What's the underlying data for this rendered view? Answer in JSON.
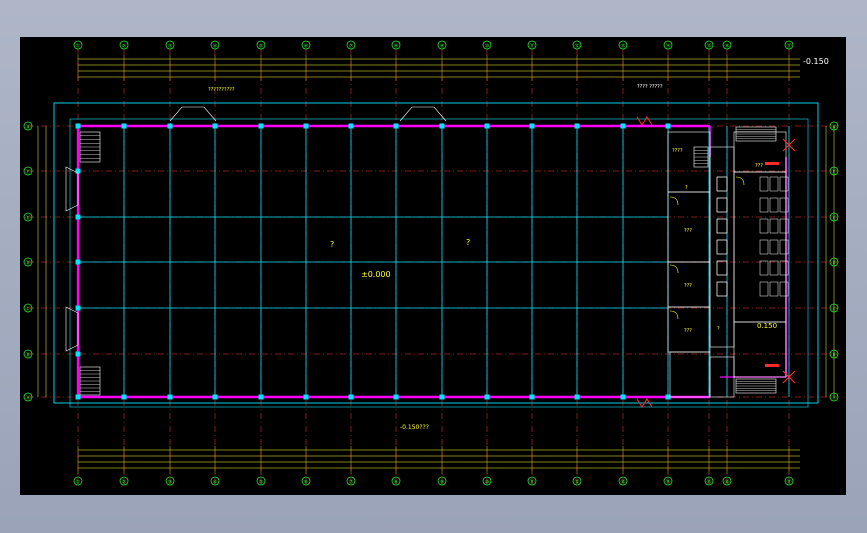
{
  "viewport": {
    "background": "#000000",
    "outer_background": "#a3abbf"
  },
  "colors": {
    "wall": "#ff00ff",
    "axis": "#ff3b3b",
    "column_line": "#00e5ff",
    "dimension": "#ffff33",
    "bubble": "#33ff33",
    "text_yellow": "#ffff33",
    "text_white": "#ffffff",
    "text_green": "#33ff33",
    "furniture": "#ffffff",
    "accent_red": "#ff2a2a"
  },
  "axes_top": [
    "①",
    "②",
    "③",
    "④",
    "⑤",
    "⑥",
    "⑦",
    "⑧",
    "⑨",
    "⑩",
    "⑪",
    "⑫",
    "⑬",
    "⑭",
    "⑮",
    "⑯",
    "⑰"
  ],
  "axes_left": [
    "Ⓖ",
    "Ⓕ",
    "Ⓔ",
    "Ⓓ",
    "Ⓒ",
    "Ⓑ",
    "Ⓐ"
  ],
  "labels": {
    "elevation_top": "-0.150",
    "elevation_main": "±0.000",
    "elevation_side": "0.150",
    "elevation_bottom": "-0.150???",
    "hall_mark_1": "?",
    "hall_mark_2": "?",
    "room_labels": [
      "???",
      "???",
      "???",
      "???",
      "?",
      "?"
    ],
    "note_top": "??????????",
    "note_top_right": "???? ?????",
    "room_tag": "????"
  }
}
